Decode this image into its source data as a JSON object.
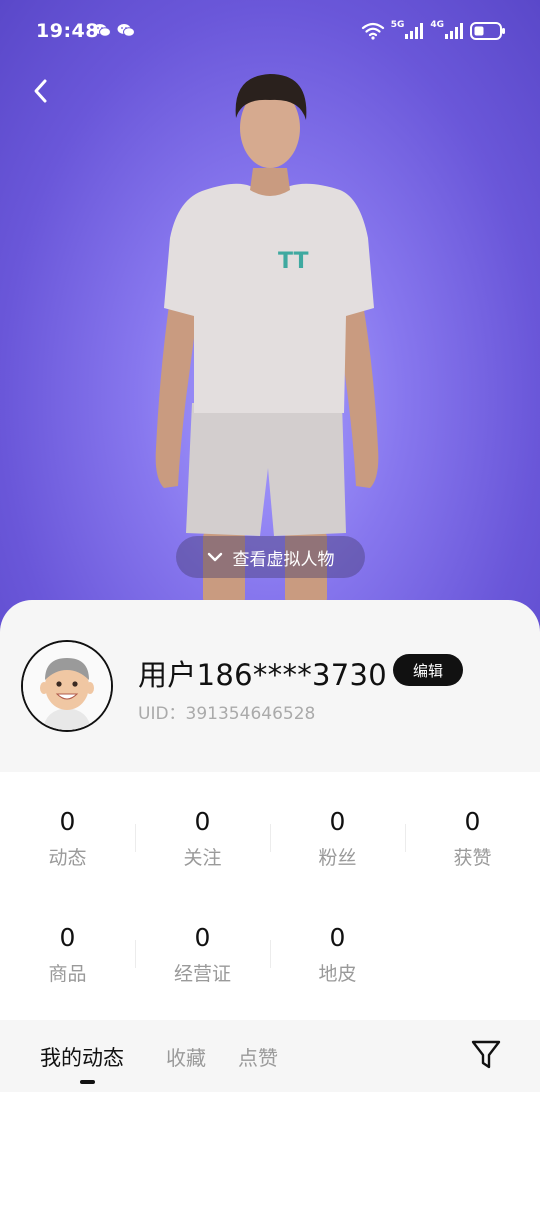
{
  "status_bar": {
    "time": "19:48",
    "net1": "5G",
    "net2": "4G",
    "icons": [
      "wechat-icon",
      "wechat-icon",
      "wifi-icon",
      "signal-icon",
      "signal-icon",
      "battery-icon"
    ]
  },
  "hero": {
    "back_icon": "chevron-left-icon",
    "view_avatar_label": "查看虚拟人物",
    "shirt_logo": "TT",
    "colors": {
      "background": "#7b6ae6"
    }
  },
  "profile": {
    "name": "用户186****3730",
    "edit_label": "编辑",
    "uid": "UID：391354646528"
  },
  "stats": {
    "items": [
      {
        "value": "0",
        "label": "动态"
      },
      {
        "value": "0",
        "label": "关注"
      },
      {
        "value": "0",
        "label": "粉丝"
      },
      {
        "value": "0",
        "label": "获赞"
      },
      {
        "value": "0",
        "label": "商品"
      },
      {
        "value": "0",
        "label": "经营证"
      },
      {
        "value": "0",
        "label": "地皮"
      }
    ]
  },
  "tabs": {
    "items": [
      {
        "label": "我的动态",
        "active": true
      },
      {
        "label": "收藏",
        "active": false
      },
      {
        "label": "点赞",
        "active": false
      }
    ],
    "filter_icon": "filter-icon"
  }
}
